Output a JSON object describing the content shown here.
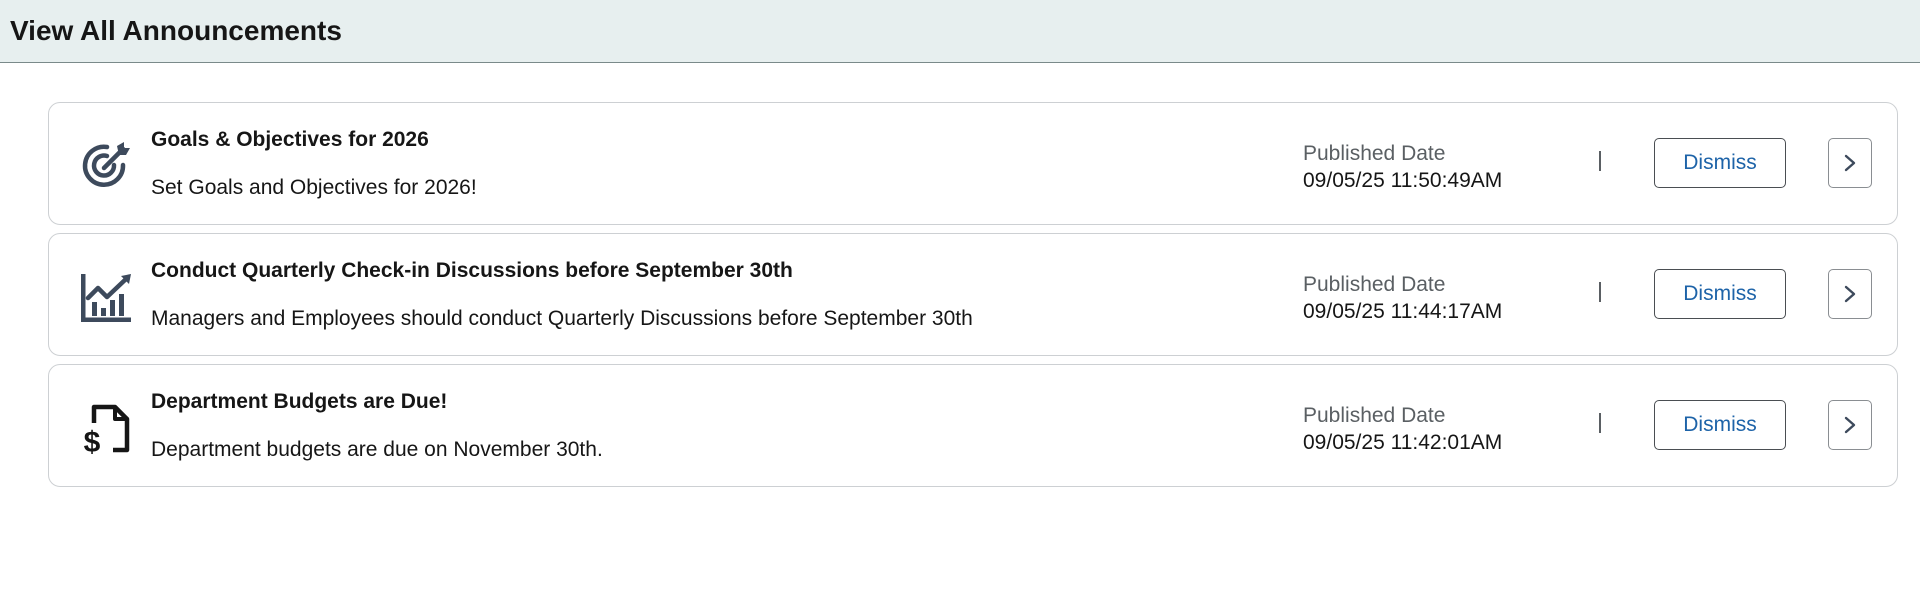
{
  "page": {
    "title": "View All Announcements"
  },
  "announcements": [
    {
      "icon": "target-icon",
      "title": "Goals & Objectives for 2026",
      "description": "Set Goals and Objectives for 2026!",
      "date_label": "Published Date",
      "date_value": "09/05/25 11:50:49AM",
      "divider": "|",
      "dismiss_label": "Dismiss"
    },
    {
      "icon": "growth-chart-icon",
      "title": "Conduct Quarterly Check-in Discussions before September 30th",
      "description": "Managers and Employees should conduct Quarterly Discussions before September 30th",
      "date_label": "Published Date",
      "date_value": "09/05/25 11:44:17AM",
      "divider": "|",
      "dismiss_label": "Dismiss"
    },
    {
      "icon": "budget-document-icon",
      "title": "Department Budgets are Due!",
      "description": "Department budgets are due on November 30th.",
      "date_label": "Published Date",
      "date_value": "09/05/25 11:42:01AM",
      "divider": "|",
      "dismiss_label": "Dismiss"
    }
  ],
  "colors": {
    "header_bg": "#e7efef",
    "icon": "#3d4a5c",
    "link": "#1d63a8",
    "border": "#cdd0d3"
  }
}
